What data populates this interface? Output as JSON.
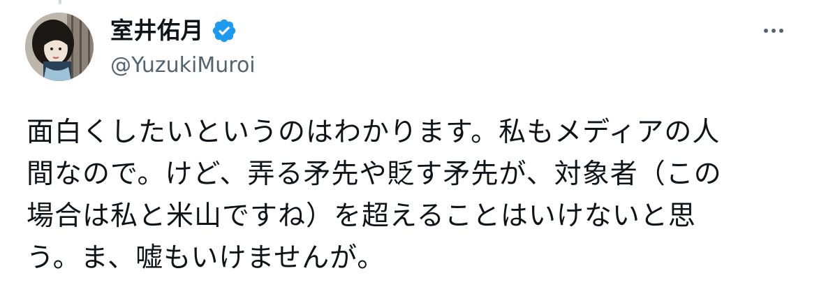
{
  "tweet": {
    "author": {
      "display_name": "室井佑月",
      "handle": "@YuzukiMuroi",
      "verified": true,
      "verified_icon": "verified-badge-icon",
      "verified_color": "#1d9bf0"
    },
    "more_icon": "more-horizontal-icon",
    "text_lines": [
      "面白くしたいというのはわかります。私もメディアの人",
      "間なので。けど、弄る矛先や貶す矛先が、対象者（この",
      "場合は私と米山ですね）を超えることはいけないと思",
      "う。ま、嘘もいけませんが。"
    ]
  },
  "colors": {
    "text": "#0f1419",
    "secondary_text": "#536471",
    "accent": "#1d9bf0",
    "background": "#ffffff"
  }
}
